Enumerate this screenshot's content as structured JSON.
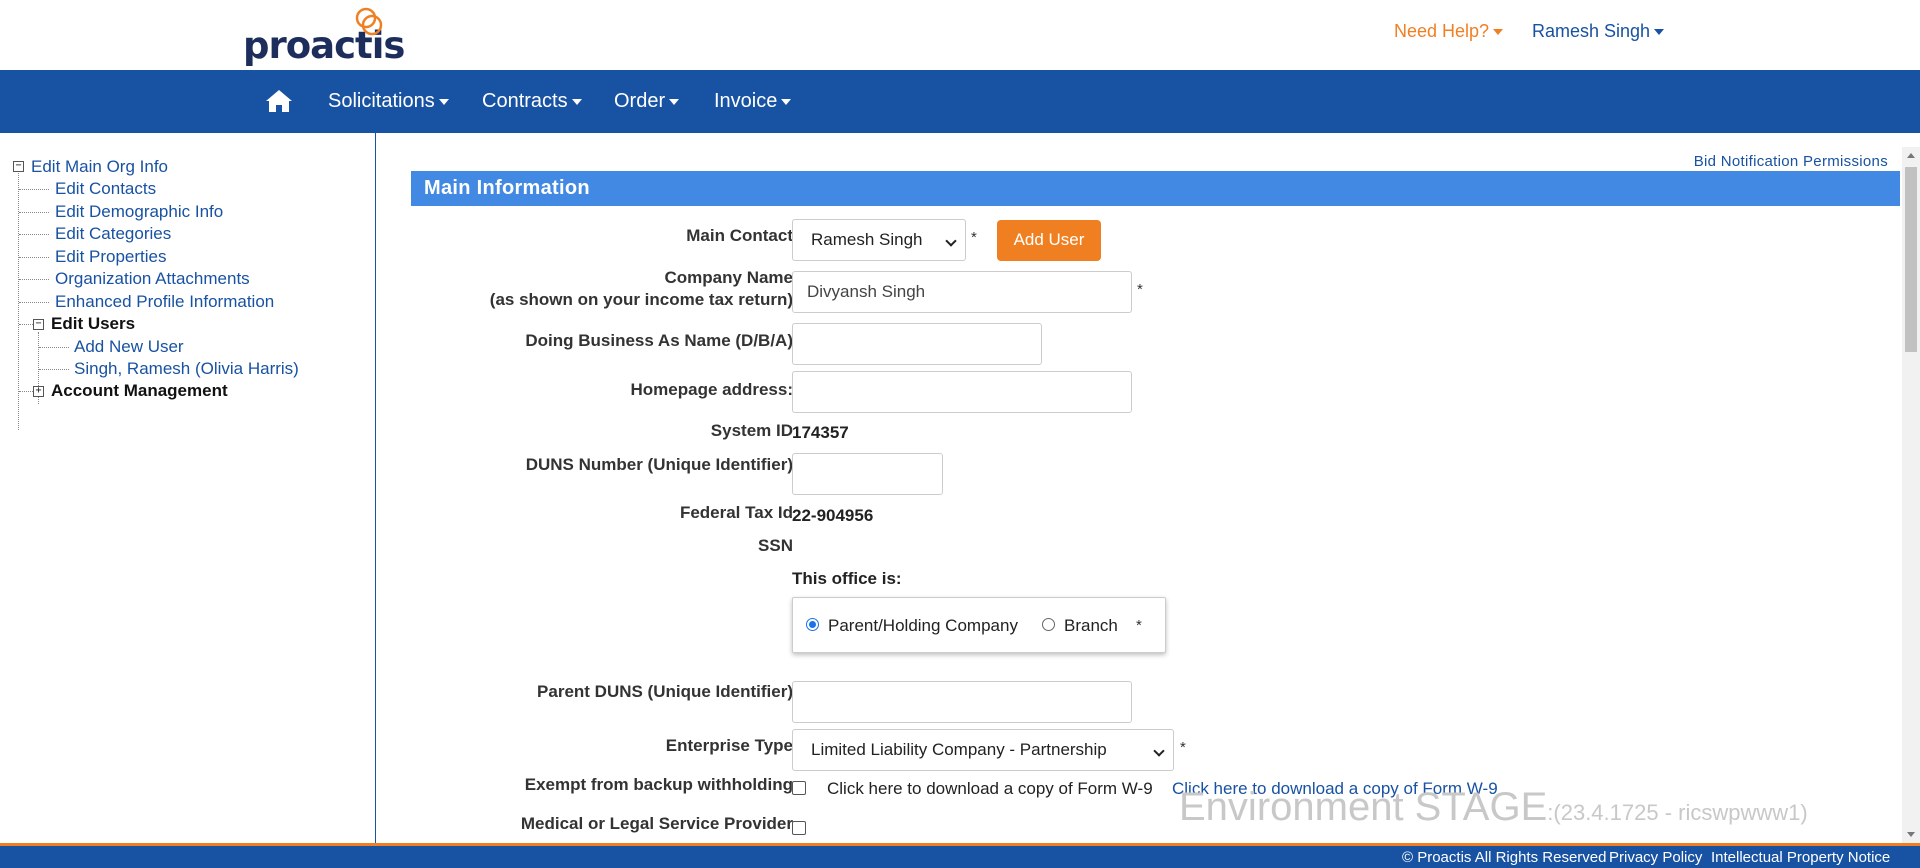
{
  "header": {
    "logo_text": "proactis",
    "help_label": "Need Help?",
    "user_label": "Ramesh Singh"
  },
  "nav": {
    "items": [
      {
        "label": "Solicitations"
      },
      {
        "label": "Contracts"
      },
      {
        "label": "Order"
      },
      {
        "label": "Invoice"
      }
    ]
  },
  "sidebar": {
    "root": "Edit Main Org Info",
    "items": [
      {
        "label": "Edit Contacts"
      },
      {
        "label": "Edit Demographic Info"
      },
      {
        "label": "Edit Categories"
      },
      {
        "label": "Edit Properties"
      },
      {
        "label": "Organization Attachments"
      },
      {
        "label": "Enhanced Profile Information"
      }
    ],
    "edit_users": "Edit Users",
    "user_items": [
      {
        "label": "Add New User"
      },
      {
        "label": "Singh, Ramesh (Olivia Harris)"
      }
    ],
    "account_management": "Account Management"
  },
  "main": {
    "bid_link": "Bid Notification Permissions",
    "section_title": "Main Information",
    "fields": {
      "main_contact": {
        "label": "Main Contact",
        "value": "Ramesh Singh"
      },
      "add_user_button": "Add User",
      "company_name": {
        "label1": "Company Name",
        "label2": "(as shown on your income tax return)",
        "value": "Divyansh Singh"
      },
      "dba": {
        "label": "Doing Business As Name (D/B/A)",
        "value": ""
      },
      "homepage": {
        "label": "Homepage address:",
        "value": ""
      },
      "system_id": {
        "label": "System ID",
        "value": "174357"
      },
      "duns": {
        "label": "DUNS Number (Unique Identifier)",
        "value": ""
      },
      "federal_tax": {
        "label": "Federal Tax Id",
        "value": "22-904956"
      },
      "ssn": {
        "label": "SSN",
        "value": ""
      },
      "office": {
        "label": "This office is:",
        "options": [
          {
            "label": "Parent/Holding Company",
            "selected": true
          },
          {
            "label": "Branch",
            "selected": false
          }
        ]
      },
      "parent_duns": {
        "label": "Parent DUNS (Unique Identifier)",
        "value": ""
      },
      "enterprise_type": {
        "label": "Enterprise Type",
        "value": "Limited Liability Company - Partnership"
      },
      "exempt": {
        "label": "Exempt from backup withholding",
        "text": "Click here to download a copy of Form W-9",
        "link": "Click here to download a copy of Form W-9"
      },
      "medical": {
        "label": "Medical or Legal Service Provider"
      },
      "required_mark": "*"
    },
    "environment": {
      "big": "Environment STAGE",
      "small": ":(23.4.1725 - ricswpwww1)"
    }
  },
  "footer": {
    "copyright": "© Proactis All Rights Reserved",
    "privacy": "Privacy Policy",
    "ip": "Intellectual Property Notice"
  },
  "colors": {
    "brand_blue": "#1852a2",
    "accent_orange": "#f07f22",
    "section_blue": "#4189e3"
  }
}
